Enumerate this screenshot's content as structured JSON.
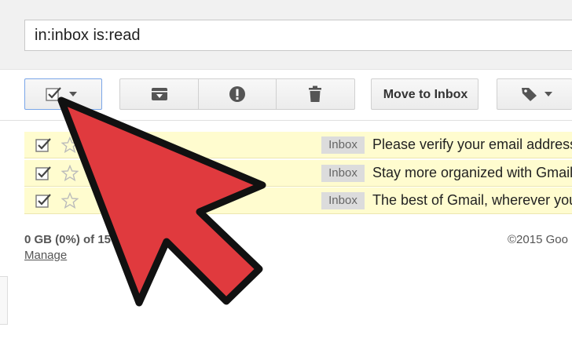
{
  "search": {
    "query": "in:inbox is:read"
  },
  "toolbar": {
    "move_label": "Move to Inbox"
  },
  "rows": [
    {
      "tag": "Inbox",
      "text": "Please verify your email address"
    },
    {
      "tag": "Inbox",
      "text": "Stay more organized with Gmail"
    },
    {
      "tag": "Inbox",
      "text": "The best of Gmail, wherever you"
    }
  ],
  "footer": {
    "storage": "0 GB (0%) of 15",
    "manage": "Manage",
    "copyright": "©2015 Goo"
  },
  "colors": {
    "row_highlight": "#fffccf",
    "arrow_fill": "#e03a3e",
    "arrow_stroke": "#111111"
  },
  "icons": [
    "checkbox-icon",
    "chevron-down-icon",
    "archive-icon",
    "report-spam-icon",
    "trash-icon",
    "label-icon",
    "star-icon",
    "pointer-arrow"
  ]
}
